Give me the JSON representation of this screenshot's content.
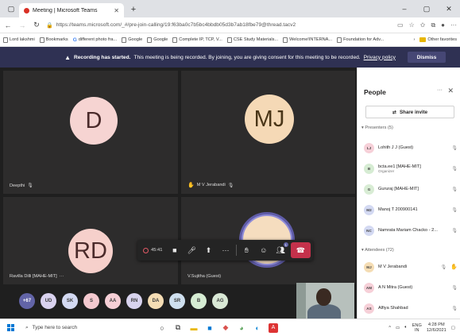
{
  "browser": {
    "tab_title": "Meeting | Microsoft Teams",
    "url": "https://teams.microsoft.com/_#/pre-join-calling/19:f63ba0c7b5bc4bbdb05d3b7ab18fbe79@thread.tacv2",
    "bookmarks": [
      "Lord lakshmi",
      "Bookmarks",
      "different photo fra...",
      "Google",
      "Google",
      "Complete IP, TCP, V...",
      "CSE Study Materials...",
      "Welcome!INTERNA...",
      "Foundation for Adv..."
    ],
    "other_favorites": "Other favorites"
  },
  "banner": {
    "strong": "Recording has started.",
    "text": "This meeting is being recorded. By joining, you are giving consent for this meeting to be recorded.",
    "link": "Privacy policy",
    "dismiss": "Dismiss"
  },
  "tiles": [
    {
      "initials": "D",
      "name": "Deepthi",
      "color": "#f6d4d2"
    },
    {
      "initials": "MJ",
      "name": "M V Jerabandi",
      "color": "#f5d9b6"
    },
    {
      "initials": "RD",
      "name": "Ravilla Dilli [MAHE-MIT]",
      "color": "#f6d0cb"
    },
    {
      "initials": "",
      "name": "V.Sujitha (Guest)",
      "color": "#f5ddbf"
    }
  ],
  "controls": {
    "timer": "45:41",
    "reactions_badge": "1"
  },
  "strip": [
    {
      "label": "+67",
      "color": "#6264a7"
    },
    {
      "label": "UD",
      "color": "#d9d2ef"
    },
    {
      "label": "SK",
      "color": "#d3d9f2"
    },
    {
      "label": "S",
      "color": "#f4c9cf"
    },
    {
      "label": "AA",
      "color": "#f6cfd6"
    },
    {
      "label": "RN",
      "color": "#d8d3ee"
    },
    {
      "label": "DA",
      "color": "#f5ddb4"
    },
    {
      "label": "SR",
      "color": "#cfe0ef"
    },
    {
      "label": "B",
      "color": "#d6ecd3"
    },
    {
      "label": "AG",
      "color": "#d9e8d5"
    }
  ],
  "panel": {
    "title": "People",
    "share": "Share invite",
    "presenters_header": "Presenters (5)",
    "attendees_header": "Attendees (72)",
    "presenters": [
      {
        "initials": "LJ",
        "name": "Lohith J J (Guest)",
        "role": "",
        "color": "#f6d0d8"
      },
      {
        "initials": "B",
        "name": "bcta.ee1 [MAHE-MIT]",
        "role": "Organizer",
        "color": "#d6ecd3"
      },
      {
        "initials": "G",
        "name": "Gururaj [MAHE-MIT]",
        "role": "",
        "color": "#d8ecd4"
      },
      {
        "initials": "M2",
        "name": "Manoj T 200900141",
        "role": "",
        "color": "#d3d9f2"
      },
      {
        "initials": "NC",
        "name": "Namrata Mariam Chacko - 2...",
        "role": "",
        "color": "#d3d9f2"
      }
    ],
    "attendees": [
      {
        "initials": "MJ",
        "name": "M V Jerabandi",
        "role": "",
        "color": "#f5ddb4"
      },
      {
        "initials": "AM",
        "name": "A N Mitra (Guest)",
        "role": "",
        "color": "#f6d0d8"
      },
      {
        "initials": "AS",
        "name": "Alfiya Shahbad",
        "role": "",
        "color": "#f6d0d8"
      }
    ]
  },
  "taskbar": {
    "search": "Type here to search",
    "lang": "ENG",
    "lang2": "IN",
    "time": "4:28 PM",
    "date": "12/6/2021"
  }
}
